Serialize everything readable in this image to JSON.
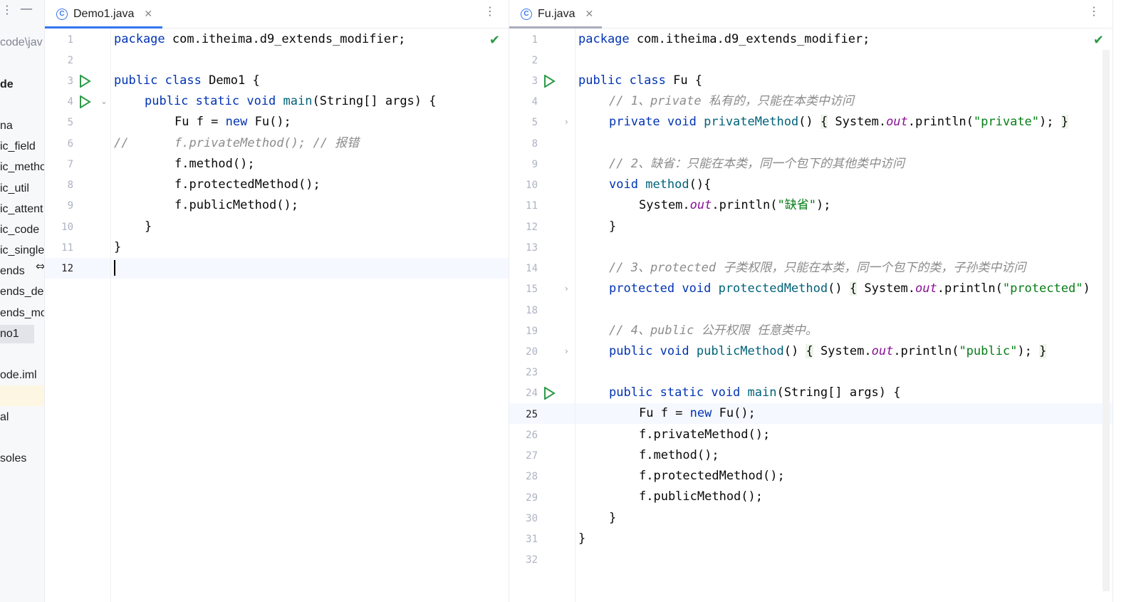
{
  "sidebar": {
    "items": [
      {
        "label": "code\\jav",
        "style": "dim"
      },
      {
        "label": "de",
        "style": "bold"
      },
      {
        "label": "na",
        "style": ""
      },
      {
        "label": "ic_field",
        "style": ""
      },
      {
        "label": "ic_metho",
        "style": ""
      },
      {
        "label": "ic_util",
        "style": ""
      },
      {
        "label": "ic_attent",
        "style": ""
      },
      {
        "label": "ic_code",
        "style": ""
      },
      {
        "label": "ic_single",
        "style": ""
      },
      {
        "label": "ends",
        "style": ""
      },
      {
        "label": "ends_der",
        "style": ""
      },
      {
        "label": "ends_mo",
        "style": ""
      },
      {
        "label": "no1",
        "style": "sel"
      },
      {
        "label": "ode.iml",
        "style": ""
      },
      {
        "label": "al",
        "style": ""
      },
      {
        "label": "soles",
        "style": ""
      }
    ]
  },
  "left_editor": {
    "tab_label": "Demo1.java",
    "line_numbers": [
      "1",
      "2",
      "3",
      "4",
      "5",
      "6",
      "7",
      "8",
      "9",
      "10",
      "11",
      "12"
    ],
    "current_line": "12"
  },
  "right_editor": {
    "tab_label": "Fu.java",
    "line_numbers": [
      "1",
      "2",
      "3",
      "4",
      "5",
      "8",
      "9",
      "10",
      "11",
      "12",
      "13",
      "14",
      "15",
      "18",
      "19",
      "20",
      "23",
      "24",
      "25",
      "26",
      "27",
      "28",
      "29",
      "30",
      "31",
      "32"
    ],
    "current_line": "25"
  },
  "code": {
    "pkg": "package",
    "pkg_name": " com.itheima.d9_extends_modifier;",
    "public": "public",
    "class": "class",
    "static": "static",
    "void": "void",
    "private": "private",
    "protected": "protected",
    "new": "new",
    "main": "main",
    "main_args": "(String[] args) {",
    "demo1_name": " Demo1 {",
    "fu_name": " Fu {",
    "fu_decl": "Fu f = ",
    "fu_ctor": " Fu();",
    "comment_slashes": "//",
    "commented_call": "f.privateMethod(); // 报错",
    "call_private": "f.privateMethod();",
    "call_method": "f.method();",
    "call_protected": "f.protectedMethod();",
    "call_public": "f.publicMethod();",
    "close_brace": "}",
    "comment_1": "// 1、private 私有的，只能在本类中访问",
    "comment_2": "// 2、缺省：只能在本类，同一个包下的其他类中访问",
    "comment_3": "// 3、protected 子类权限，只能在本类，同一个包下的类，子孙类中访问",
    "comment_4": "// 4、public 公开权限 任意类中。",
    "private_method": "privateMethod",
    "method": "method",
    "protected_method": "protectedMethod",
    "public_method": "publicMethod",
    "parens": "()",
    "open_brace": "{",
    "method_tail": "(){",
    "system": "System.",
    "out": "out",
    "println": ".println(",
    "str_private": "\"private\"",
    "str_default": "\"缺省\"",
    "str_protected": "\"protected\"",
    "str_public": "\"public\"",
    "stmt_end": ");",
    "protected_tail": ")"
  }
}
